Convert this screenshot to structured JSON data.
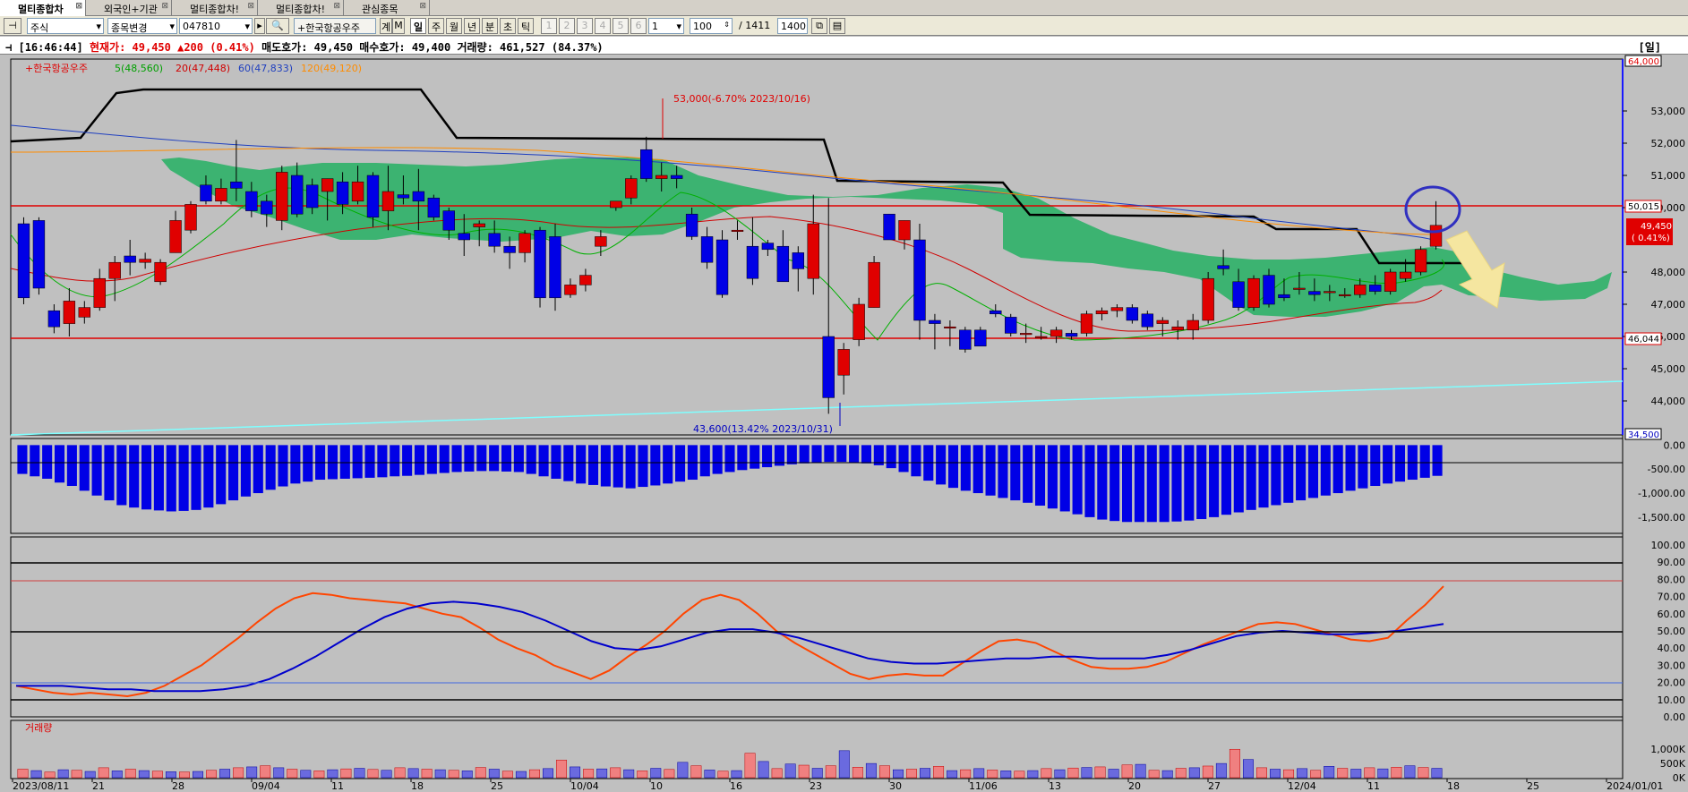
{
  "tabs": [
    {
      "label": "멀티종합차"
    },
    {
      "label": "외국인+기관"
    },
    {
      "label": "멀티종합차!"
    },
    {
      "label": "멀티종합차!"
    },
    {
      "label": "관심종목"
    }
  ],
  "toolbar": {
    "market_select": "주식",
    "change_button": "종목변경",
    "code": "047810",
    "name": "+한국항공우주",
    "gye_button": "계",
    "m_button": "M",
    "periods": [
      "일",
      "주",
      "월",
      "년",
      "분",
      "초",
      "틱"
    ],
    "selected_period": "일",
    "pages": [
      "1",
      "2",
      "3",
      "4",
      "5",
      "6"
    ],
    "page_select": "1",
    "count": "100",
    "slash_total": "/ 1411",
    "display_count": "1400"
  },
  "info": {
    "time": "[16:46:44]",
    "current_price_label": "현재가: 49,450",
    "change": "▲200",
    "change_pct": "(0.41%)",
    "ask_label": "매도호가: 49,450",
    "bid_label": "매수호가: 49,400",
    "volume_label": "거래량: 461,527",
    "volume_pct": "(84.37%)",
    "period_label": "[일]"
  },
  "legend": {
    "name": "+한국항공우주",
    "ma5": "5(48,560)",
    "ma20": "20(47,448)",
    "ma60": "60(47,833)",
    "ma120": "120(49,120)"
  },
  "colors": {
    "up": "#e00000",
    "down": "#0000e6",
    "cloud": "#3cb371",
    "ma5": "#00b000",
    "ma20": "#d00000",
    "ma60": "#1f3fbf",
    "ma120": "#ff8c00",
    "baseline": "#000000",
    "trendline": "#7fffff",
    "stoch_k": "#ff4500",
    "stoch_d": "#0000cc"
  },
  "annotations": {
    "high": "53,000(-6.70% 2023/10/16)",
    "low": "43,600(13.42% 2023/10/31)",
    "price_right_top": "64,000",
    "price_right_bottom": "34,500",
    "resist_label": "50,015",
    "support_label": "46,044",
    "current_label": "49,450",
    "current_pct": "( 0.41%)"
  },
  "volume_title": "거래량",
  "chart_data": [
    {
      "type": "candlestick",
      "title": "+한국항공우주",
      "y_ticks": [
        "53,000",
        "52,000",
        "51,000",
        "50,000",
        "48,000",
        "47,000",
        "46,000",
        "45,000",
        "44,000"
      ],
      "ylim": [
        43000,
        54500
      ],
      "x_ticks": [
        "2023/08/11",
        "21",
        "28",
        "09/04",
        "11",
        "18",
        "25",
        "10/04",
        "10",
        "16",
        "23",
        "30",
        "11/06",
        "13",
        "20",
        "27",
        "12/04",
        "11",
        "18",
        "25",
        "2024/01/01"
      ],
      "candles": [
        {
          "o": 49500,
          "h": 49700,
          "l": 47000,
          "c": 47200
        },
        {
          "o": 49600,
          "h": 49700,
          "l": 47300,
          "c": 47500
        },
        {
          "o": 46800,
          "h": 47000,
          "l": 46100,
          "c": 46300
        },
        {
          "o": 46400,
          "h": 47500,
          "l": 46000,
          "c": 47100
        },
        {
          "o": 46600,
          "h": 47100,
          "l": 46400,
          "c": 46900
        },
        {
          "o": 46900,
          "h": 48100,
          "l": 46800,
          "c": 47800
        },
        {
          "o": 47800,
          "h": 48500,
          "l": 47100,
          "c": 48300
        },
        {
          "o": 48500,
          "h": 49000,
          "l": 47900,
          "c": 48300
        },
        {
          "o": 48300,
          "h": 48600,
          "l": 48100,
          "c": 48400
        },
        {
          "o": 47700,
          "h": 48400,
          "l": 47600,
          "c": 48300
        },
        {
          "o": 48600,
          "h": 49900,
          "l": 48600,
          "c": 49600
        },
        {
          "o": 49300,
          "h": 50200,
          "l": 49200,
          "c": 50100
        },
        {
          "o": 50700,
          "h": 51000,
          "l": 50100,
          "c": 50200
        },
        {
          "o": 50200,
          "h": 50900,
          "l": 50100,
          "c": 50600
        },
        {
          "o": 50800,
          "h": 52100,
          "l": 50200,
          "c": 50600
        },
        {
          "o": 50500,
          "h": 50800,
          "l": 49700,
          "c": 49900
        },
        {
          "o": 50200,
          "h": 50400,
          "l": 49400,
          "c": 49800
        },
        {
          "o": 49600,
          "h": 51300,
          "l": 49300,
          "c": 51100
        },
        {
          "o": 51000,
          "h": 51400,
          "l": 49700,
          "c": 49800
        },
        {
          "o": 50700,
          "h": 50900,
          "l": 49800,
          "c": 50000
        },
        {
          "o": 50500,
          "h": 50900,
          "l": 49600,
          "c": 50900
        },
        {
          "o": 50800,
          "h": 51100,
          "l": 49800,
          "c": 50100
        },
        {
          "o": 50200,
          "h": 51300,
          "l": 50100,
          "c": 50800
        },
        {
          "o": 51000,
          "h": 51100,
          "l": 49400,
          "c": 49700
        },
        {
          "o": 49900,
          "h": 51300,
          "l": 49300,
          "c": 50500
        },
        {
          "o": 50400,
          "h": 51000,
          "l": 50100,
          "c": 50300
        },
        {
          "o": 50500,
          "h": 51200,
          "l": 49300,
          "c": 50200
        },
        {
          "o": 50300,
          "h": 50400,
          "l": 49600,
          "c": 49700
        },
        {
          "o": 49900,
          "h": 50000,
          "l": 49000,
          "c": 49300
        },
        {
          "o": 49200,
          "h": 49800,
          "l": 48500,
          "c": 49000
        },
        {
          "o": 49400,
          "h": 49600,
          "l": 48800,
          "c": 49500
        },
        {
          "o": 49200,
          "h": 49600,
          "l": 48600,
          "c": 48800
        },
        {
          "o": 48800,
          "h": 49100,
          "l": 48100,
          "c": 48600
        },
        {
          "o": 48600,
          "h": 49300,
          "l": 48300,
          "c": 49200
        },
        {
          "o": 49300,
          "h": 49400,
          "l": 46900,
          "c": 47200
        },
        {
          "o": 49100,
          "h": 49500,
          "l": 46800,
          "c": 47200
        },
        {
          "o": 47300,
          "h": 47800,
          "l": 47200,
          "c": 47600
        },
        {
          "o": 47600,
          "h": 48100,
          "l": 47400,
          "c": 47900
        },
        {
          "o": 48800,
          "h": 49300,
          "l": 48500,
          "c": 49100
        },
        {
          "o": 50000,
          "h": 50200,
          "l": 49900,
          "c": 50200
        },
        {
          "o": 50300,
          "h": 51000,
          "l": 50100,
          "c": 50900
        },
        {
          "o": 51800,
          "h": 52200,
          "l": 50800,
          "c": 50900
        },
        {
          "o": 50900,
          "h": 51400,
          "l": 50500,
          "c": 51000
        },
        {
          "o": 51000,
          "h": 51300,
          "l": 50600,
          "c": 50900
        },
        {
          "o": 49800,
          "h": 50000,
          "l": 49000,
          "c": 49100
        },
        {
          "o": 49100,
          "h": 49400,
          "l": 48100,
          "c": 48300
        },
        {
          "o": 49000,
          "h": 49300,
          "l": 47200,
          "c": 47300
        },
        {
          "o": 49300,
          "h": 49600,
          "l": 49000,
          "c": 49300
        },
        {
          "o": 48800,
          "h": 49700,
          "l": 47600,
          "c": 47800
        },
        {
          "o": 48900,
          "h": 49000,
          "l": 48500,
          "c": 48700
        },
        {
          "o": 48800,
          "h": 49300,
          "l": 47700,
          "c": 47700
        },
        {
          "o": 48600,
          "h": 48800,
          "l": 47400,
          "c": 48100
        },
        {
          "o": 47800,
          "h": 50400,
          "l": 47300,
          "c": 49500
        },
        {
          "o": 46000,
          "h": 50300,
          "l": 43600,
          "c": 44100
        },
        {
          "o": 44800,
          "h": 45800,
          "l": 44200,
          "c": 45600
        },
        {
          "o": 45900,
          "h": 47200,
          "l": 45700,
          "c": 47000
        },
        {
          "o": 46900,
          "h": 48500,
          "l": 46900,
          "c": 48300
        },
        {
          "o": 49800,
          "h": 49800,
          "l": 49000,
          "c": 49000
        },
        {
          "o": 49000,
          "h": 49600,
          "l": 48700,
          "c": 49600
        },
        {
          "o": 49000,
          "h": 49500,
          "l": 45900,
          "c": 46500
        },
        {
          "o": 46500,
          "h": 46700,
          "l": 45600,
          "c": 46400
        },
        {
          "o": 46300,
          "h": 46500,
          "l": 45700,
          "c": 46300
        },
        {
          "o": 46200,
          "h": 46300,
          "l": 45500,
          "c": 45600
        },
        {
          "o": 46200,
          "h": 46300,
          "l": 45700,
          "c": 45700
        },
        {
          "o": 46800,
          "h": 47000,
          "l": 46600,
          "c": 46700
        },
        {
          "o": 46600,
          "h": 46700,
          "l": 46000,
          "c": 46100
        },
        {
          "o": 46100,
          "h": 46400,
          "l": 45800,
          "c": 46100
        },
        {
          "o": 46000,
          "h": 46300,
          "l": 45900,
          "c": 46000
        },
        {
          "o": 46000,
          "h": 46300,
          "l": 45800,
          "c": 46200
        },
        {
          "o": 46100,
          "h": 46200,
          "l": 45900,
          "c": 46000
        },
        {
          "o": 46100,
          "h": 46800,
          "l": 46000,
          "c": 46700
        },
        {
          "o": 46700,
          "h": 46900,
          "l": 46500,
          "c": 46800
        },
        {
          "o": 46800,
          "h": 47000,
          "l": 46600,
          "c": 46900
        },
        {
          "o": 46900,
          "h": 47000,
          "l": 46400,
          "c": 46500
        },
        {
          "o": 46700,
          "h": 46800,
          "l": 46200,
          "c": 46300
        },
        {
          "o": 46400,
          "h": 46600,
          "l": 46000,
          "c": 46500
        },
        {
          "o": 46200,
          "h": 46500,
          "l": 45900,
          "c": 46300
        },
        {
          "o": 46200,
          "h": 46700,
          "l": 45900,
          "c": 46500
        },
        {
          "o": 46500,
          "h": 48000,
          "l": 46400,
          "c": 47800
        },
        {
          "o": 48200,
          "h": 48700,
          "l": 47900,
          "c": 48100
        },
        {
          "o": 47700,
          "h": 48100,
          "l": 46800,
          "c": 46900
        },
        {
          "o": 46900,
          "h": 47900,
          "l": 46800,
          "c": 47800
        },
        {
          "o": 47900,
          "h": 48100,
          "l": 46900,
          "c": 47000
        },
        {
          "o": 47300,
          "h": 47800,
          "l": 47100,
          "c": 47200
        },
        {
          "o": 47500,
          "h": 48000,
          "l": 47300,
          "c": 47500
        },
        {
          "o": 47400,
          "h": 47800,
          "l": 47100,
          "c": 47300
        },
        {
          "o": 47400,
          "h": 47600,
          "l": 47100,
          "c": 47400
        },
        {
          "o": 47300,
          "h": 47500,
          "l": 47200,
          "c": 47300
        },
        {
          "o": 47300,
          "h": 47800,
          "l": 47200,
          "c": 47600
        },
        {
          "o": 47600,
          "h": 47900,
          "l": 47300,
          "c": 47400
        },
        {
          "o": 47400,
          "h": 48100,
          "l": 47300,
          "c": 48000
        },
        {
          "o": 47800,
          "h": 48400,
          "l": 47700,
          "c": 48000
        },
        {
          "o": 48000,
          "h": 48800,
          "l": 47900,
          "c": 48700
        },
        {
          "o": 48800,
          "h": 50200,
          "l": 48700,
          "c": 49450
        }
      ]
    },
    {
      "type": "bar",
      "title": "",
      "y_ticks": [
        "0.00",
        "-500.00",
        "-1,000.00",
        "-1,500.00"
      ],
      "ylim": [
        -1800,
        100
      ],
      "values": [
        -600,
        -650,
        -700,
        -780,
        -850,
        -950,
        -1050,
        -1150,
        -1250,
        -1300,
        -1340,
        -1360,
        -1380,
        -1370,
        -1350,
        -1300,
        -1230,
        -1150,
        -1070,
        -1000,
        -930,
        -860,
        -800,
        -760,
        -720,
        -710,
        -700,
        -690,
        -680,
        -670,
        -650,
        -640,
        -620,
        -600,
        -580,
        -560,
        -550,
        -540,
        -540,
        -550,
        -560,
        -600,
        -650,
        -700,
        -750,
        -800,
        -830,
        -860,
        -880,
        -900,
        -870,
        -840,
        -800,
        -760,
        -720,
        -650,
        -600,
        -560,
        -520,
        -490,
        -460,
        -430,
        -400,
        -380,
        -360,
        -350,
        -350,
        -360,
        -380,
        -420,
        -480,
        -560,
        -650,
        -740,
        -820,
        -890,
        -950,
        -1000,
        -1050,
        -1100,
        -1150,
        -1200,
        -1260,
        -1320,
        -1380,
        -1440,
        -1500,
        -1550,
        -1580,
        -1600,
        -1600,
        -1600,
        -1600,
        -1590,
        -1570,
        -1540,
        -1500,
        -1450,
        -1400,
        -1350,
        -1300,
        -1250,
        -1200,
        -1150,
        -1100,
        -1050,
        -1000,
        -950,
        -900,
        -850,
        -800,
        -760,
        -720,
        -680,
        -640
      ]
    },
    {
      "type": "line",
      "title": "",
      "y_ticks": [
        "100.00",
        "90.00",
        "80.00",
        "70.00",
        "60.00",
        "50.00",
        "40.00",
        "30.00",
        "20.00",
        "10.00",
        "0.00"
      ],
      "ylim": [
        0,
        100
      ],
      "series": [
        {
          "values": [
            18,
            16,
            14,
            13,
            14,
            13,
            12,
            14,
            18,
            24,
            30,
            38,
            46,
            55,
            63,
            69,
            72,
            71,
            69,
            68,
            67,
            66,
            63,
            60,
            58,
            52,
            45,
            40,
            36,
            30,
            26,
            22,
            27,
            35,
            42,
            50,
            60,
            68,
            71,
            68,
            60,
            50,
            43,
            37,
            31,
            25,
            22,
            24,
            25,
            24,
            24,
            31,
            38,
            44,
            45,
            43,
            38,
            33,
            29,
            28,
            28,
            29,
            32,
            37,
            42,
            46,
            50,
            54,
            55,
            54,
            51,
            48,
            45,
            44,
            46,
            56,
            65,
            76
          ]
        },
        {
          "values": [
            18,
            18,
            18,
            17,
            16,
            16,
            15,
            15,
            15,
            16,
            18,
            22,
            28,
            35,
            43,
            51,
            58,
            63,
            66,
            67,
            66,
            64,
            61,
            56,
            50,
            44,
            40,
            39,
            41,
            45,
            49,
            51,
            51,
            49,
            46,
            42,
            38,
            34,
            32,
            31,
            31,
            32,
            33,
            34,
            34,
            35,
            35,
            34,
            34,
            34,
            36,
            39,
            43,
            47,
            49,
            50,
            49,
            48,
            48,
            49,
            50,
            52,
            54
          ]
        }
      ]
    },
    {
      "type": "bar",
      "title": "거래량",
      "y_ticks": [
        "1,000K",
        "500K",
        "0K"
      ],
      "ylim": [
        0,
        1700000
      ],
      "values": [
        300000,
        250000,
        200000,
        280000,
        260000,
        220000,
        350000,
        240000,
        300000,
        250000,
        230000,
        210000,
        200000,
        220000,
        260000,
        300000,
        350000,
        380000,
        420000,
        350000,
        300000,
        260000,
        240000,
        280000,
        310000,
        330000,
        290000,
        260000,
        350000,
        320000,
        300000,
        280000,
        260000,
        240000,
        360000,
        300000,
        230000,
        220000,
        280000,
        320000,
        620000,
        380000,
        300000,
        310000,
        350000,
        280000,
        240000,
        330000,
        290000,
        540000,
        420000,
        270000,
        230000,
        250000,
        860000,
        570000,
        320000,
        480000,
        440000,
        330000,
        420000,
        950000,
        370000,
        500000,
        420000,
        280000,
        300000,
        330000,
        400000,
        250000,
        280000,
        320000,
        270000,
        240000,
        230000,
        250000,
        320000,
        280000,
        340000,
        360000,
        380000,
        300000,
        450000,
        470000,
        260000,
        250000,
        330000,
        350000,
        410000,
        500000,
        1000000,
        640000,
        350000,
        300000,
        280000,
        320000,
        260000,
        400000,
        330000,
        300000,
        350000,
        310000,
        370000,
        420000,
        360000,
        330000
      ]
    }
  ]
}
